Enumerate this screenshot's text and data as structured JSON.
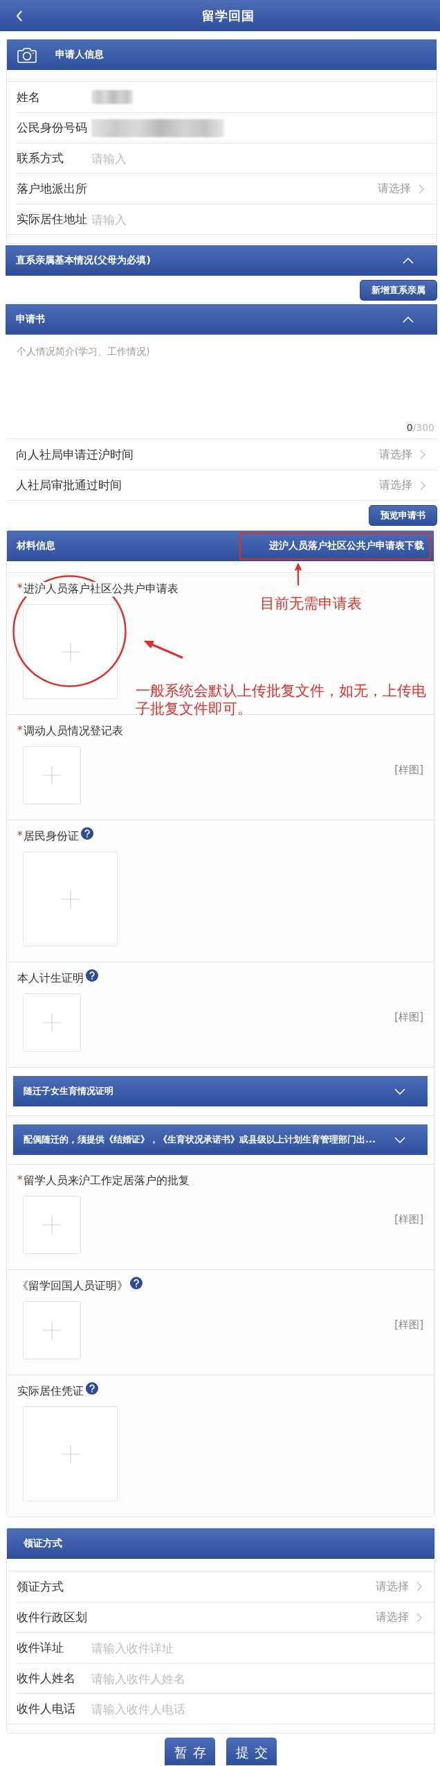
{
  "header": {
    "title": "留学回国"
  },
  "applicant": {
    "title": "申请人信息",
    "rows": [
      {
        "kind": "blurred",
        "label": "姓名"
      },
      {
        "kind": "masked",
        "label": "公民身份号码"
      },
      {
        "kind": "input",
        "label": "联系方式",
        "placeholder": "请输入"
      },
      {
        "kind": "select",
        "label": "落户地派出所",
        "value": "请选择"
      },
      {
        "kind": "input",
        "label": "实际居住地址",
        "placeholder": "请输入"
      }
    ]
  },
  "relatives": {
    "title": "直系亲属基本情况(父母为必填)",
    "expanded": true,
    "button": "新增直系亲属"
  },
  "application": {
    "title": "申请书",
    "expanded": true,
    "statement": {
      "placeholder": "个人情况简介(学习、工作情况)",
      "count": "0",
      "limit": "/300"
    },
    "rows": [
      {
        "kind": "select",
        "label": "向人社局申请迁沪时间",
        "value": "请选择"
      },
      {
        "kind": "select",
        "label": "人社局审批通过时间",
        "value": "请选择"
      }
    ],
    "button": "预览申请书"
  },
  "materials": {
    "title": "材料信息",
    "download_link": "进沪人员落户社区公共户申请表下载",
    "download_note": "目前无需申请表",
    "items": [
      {
        "kind": "large",
        "required_mark": "*",
        "label": "进沪人员落户社区公共户申请表",
        "help": false,
        "note": "一般系统会默认上传批复文件，如无，上传电子批复文件即可。"
      },
      {
        "kind": "small",
        "required_mark": "*",
        "label": "调动人员情况登记表",
        "help": false,
        "sample_link": "[样图]"
      },
      {
        "kind": "large",
        "required_mark": "*",
        "label": "居民身份证",
        "help": true
      },
      {
        "kind": "small",
        "label": "本人计生证明",
        "help": true,
        "sample_link": "[样图]"
      },
      {
        "kind": "panel",
        "title": "随迁子女生育情况证明",
        "expanded": false
      },
      {
        "kind": "panel",
        "title": "配偶随迁的，须提供《结婚证》，《生育状况承诺书》或县级以上计划生育管理部门出...",
        "expanded": false
      },
      {
        "kind": "small",
        "required_mark": "*",
        "label": "留学人员来沪工作定居落户的批复",
        "help": false,
        "sample_link": "[样图]"
      },
      {
        "kind": "small",
        "label": "《留学回国人员证明》",
        "help": true,
        "sample_link": "[样图]"
      },
      {
        "kind": "large",
        "label": "实际居住凭证",
        "help": true
      }
    ]
  },
  "delivery": {
    "title": "领证方式",
    "rows": [
      {
        "kind": "select",
        "label": "领证方式",
        "value": "请选择"
      },
      {
        "kind": "select",
        "label": "收件行政区划",
        "value": "请选择"
      },
      {
        "kind": "input",
        "label": "收件详址",
        "placeholder": "请输入收件详址"
      },
      {
        "kind": "input",
        "label": "收件人姓名",
        "placeholder": "请输入收件人姓名"
      },
      {
        "kind": "input",
        "label": "收件人电话",
        "placeholder": "请输入收件人电话"
      }
    ]
  },
  "actions": [
    {
      "label": "暂存"
    },
    {
      "label": "提交"
    }
  ]
}
